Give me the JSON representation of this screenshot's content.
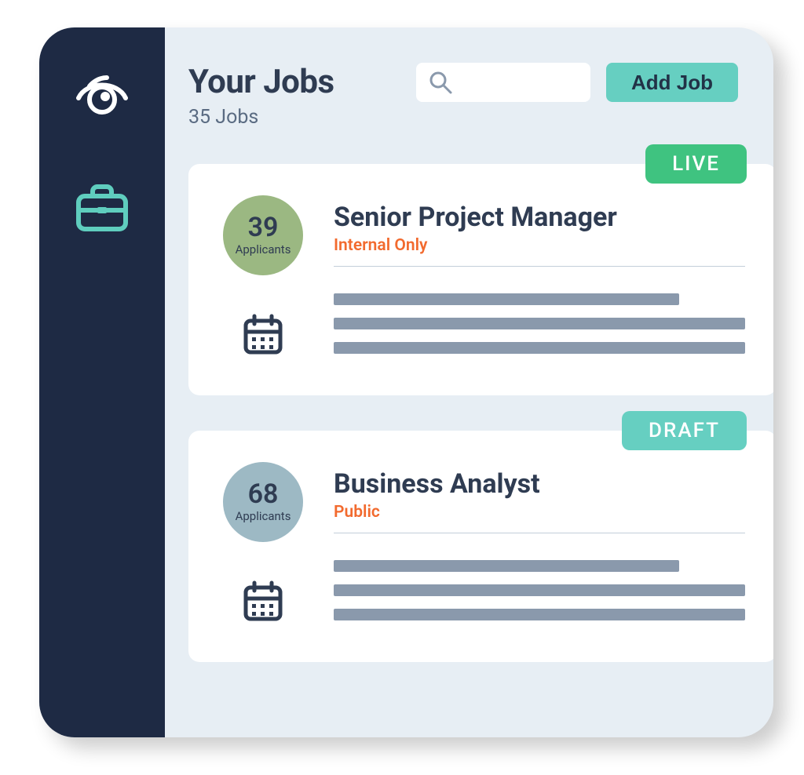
{
  "header": {
    "title": "Your Jobs",
    "subtitle": "35 Jobs",
    "add_button_label": "Add Job",
    "search_placeholder": ""
  },
  "colors": {
    "live": "#3FC380",
    "draft": "#66CFC1",
    "badge_green": "#9BB882",
    "badge_blue": "#9DB9C4"
  },
  "jobs": [
    {
      "status": "LIVE",
      "status_color": "#3FC380",
      "applicants_count": "39",
      "applicants_label": "Applicants",
      "badge_color": "#9BB882",
      "title": "Senior Project Manager",
      "visibility": "Internal Only"
    },
    {
      "status": "DRAFT",
      "status_color": "#66CFC1",
      "applicants_count": "68",
      "applicants_label": "Applicants",
      "badge_color": "#9DB9C4",
      "title": "Business Analyst",
      "visibility": "Public"
    }
  ]
}
